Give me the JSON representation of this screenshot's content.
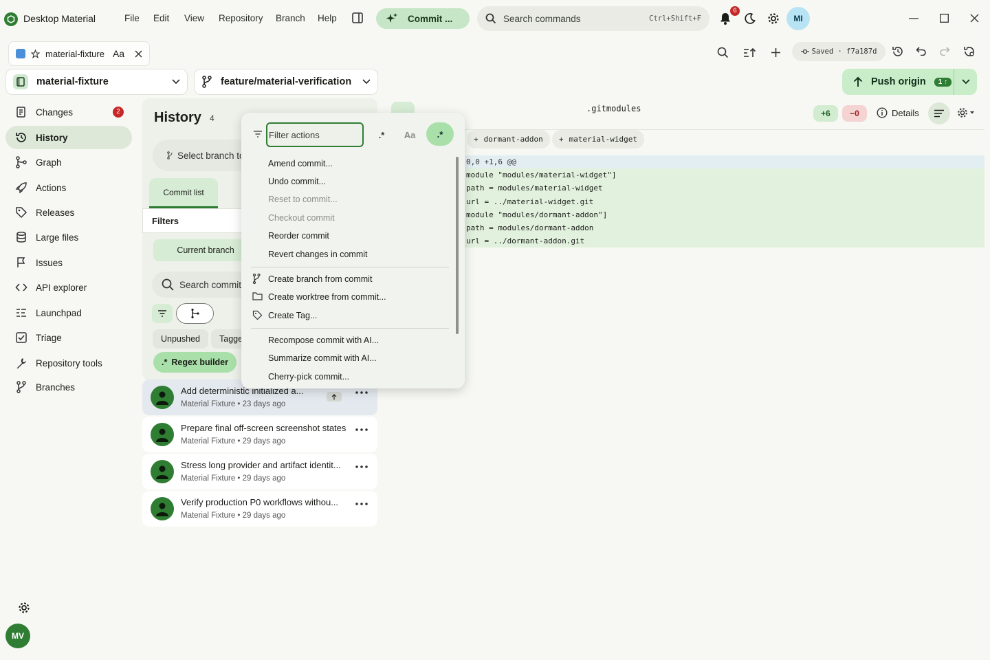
{
  "app": {
    "title": "Desktop Material",
    "menus": [
      "File",
      "Edit",
      "View",
      "Repository",
      "Branch",
      "Help"
    ],
    "commit_pill": "Commit ...",
    "search_placeholder": "Search commands",
    "search_shortcut": "Ctrl+Shift+F",
    "notification_count": "6",
    "user_initials": "MI"
  },
  "tab": {
    "name": "material-fixture",
    "font_glyph": "Aa"
  },
  "toolbar": {
    "saved_label": "Saved · f7a187d"
  },
  "repo": {
    "name": "material-fixture",
    "branch": "feature/material-verification"
  },
  "push": {
    "label": "Push origin",
    "count": "1"
  },
  "sidebar": {
    "items": [
      {
        "label": "Changes",
        "icon": "changes-icon",
        "badge": "2"
      },
      {
        "label": "History",
        "icon": "history-icon"
      },
      {
        "label": "Graph",
        "icon": "graph-icon"
      },
      {
        "label": "Actions",
        "icon": "rocket-icon"
      },
      {
        "label": "Releases",
        "icon": "tag-icon"
      },
      {
        "label": "Large files",
        "icon": "database-icon"
      },
      {
        "label": "Issues",
        "icon": "flag-icon"
      },
      {
        "label": "API explorer",
        "icon": "code-icon"
      },
      {
        "label": "Launchpad",
        "icon": "list-icon"
      },
      {
        "label": "Triage",
        "icon": "checkbox-icon"
      },
      {
        "label": "Repository tools",
        "icon": "wrench-icon"
      },
      {
        "label": "Branches",
        "icon": "branch-icon"
      }
    ],
    "user_initials": "MV"
  },
  "history": {
    "title": "History",
    "count": "4",
    "select_branch": "Select branch to",
    "tab_commit_list": "Commit list",
    "filters_label": "Filters",
    "current_branch": "Current branch",
    "search_placeholder": "Search commits",
    "chips": [
      "Unpushed",
      "Tagge"
    ],
    "regex_builder": "Regex builder",
    "commits": [
      {
        "title": "Add deterministic initialized a...",
        "meta": "Material Fixture • 23 days ago",
        "unpushed": true
      },
      {
        "title": "Prepare final off-screen screenshot states",
        "meta": "Material Fixture • 29 days ago"
      },
      {
        "title": "Stress long provider and artifact identit...",
        "meta": "Material Fixture • 29 days ago"
      },
      {
        "title": "Verify production P0 workflows withou...",
        "meta": "Material Fixture • 29 days ago"
      }
    ]
  },
  "diff": {
    "file": ".gitmodules",
    "additions": "+6",
    "deletions": "−0",
    "details_label": "Details",
    "modules": [
      "dormant-addon",
      "material-widget"
    ],
    "lines": [
      {
        "kind": "hunk",
        "text": "0,0 +1,6 @@"
      },
      {
        "kind": "add",
        "text": "module \"modules/material-widget\"]"
      },
      {
        "kind": "add",
        "text": "path = modules/material-widget"
      },
      {
        "kind": "add",
        "text": "url = ../material-widget.git"
      },
      {
        "kind": "add",
        "text": "module \"modules/dormant-addon\"]"
      },
      {
        "kind": "add",
        "text": "path = modules/dormant-addon"
      },
      {
        "kind": "add",
        "text": "url = ../dormant-addon.git"
      }
    ]
  },
  "popup": {
    "filter_placeholder": "Filter actions",
    "regex_label": ".*",
    "case_label": "Aa",
    "regex_active_label": ".*",
    "groups": [
      [
        {
          "label": "Amend commit...",
          "disabled": false
        },
        {
          "label": "Undo commit...",
          "disabled": false
        },
        {
          "label": "Reset to commit...",
          "disabled": true
        },
        {
          "label": "Checkout commit",
          "disabled": true
        },
        {
          "label": "Reorder commit",
          "disabled": false
        },
        {
          "label": "Revert changes in commit",
          "disabled": false
        }
      ],
      [
        {
          "label": "Create branch from commit",
          "icon": "branch-icon"
        },
        {
          "label": "Create worktree from commit...",
          "icon": "folder-icon"
        },
        {
          "label": "Create Tag...",
          "icon": "tag-icon"
        }
      ],
      [
        {
          "label": "Recompose commit with AI..."
        },
        {
          "label": "Summarize commit with AI..."
        },
        {
          "label": "Cherry-pick commit..."
        }
      ]
    ]
  }
}
